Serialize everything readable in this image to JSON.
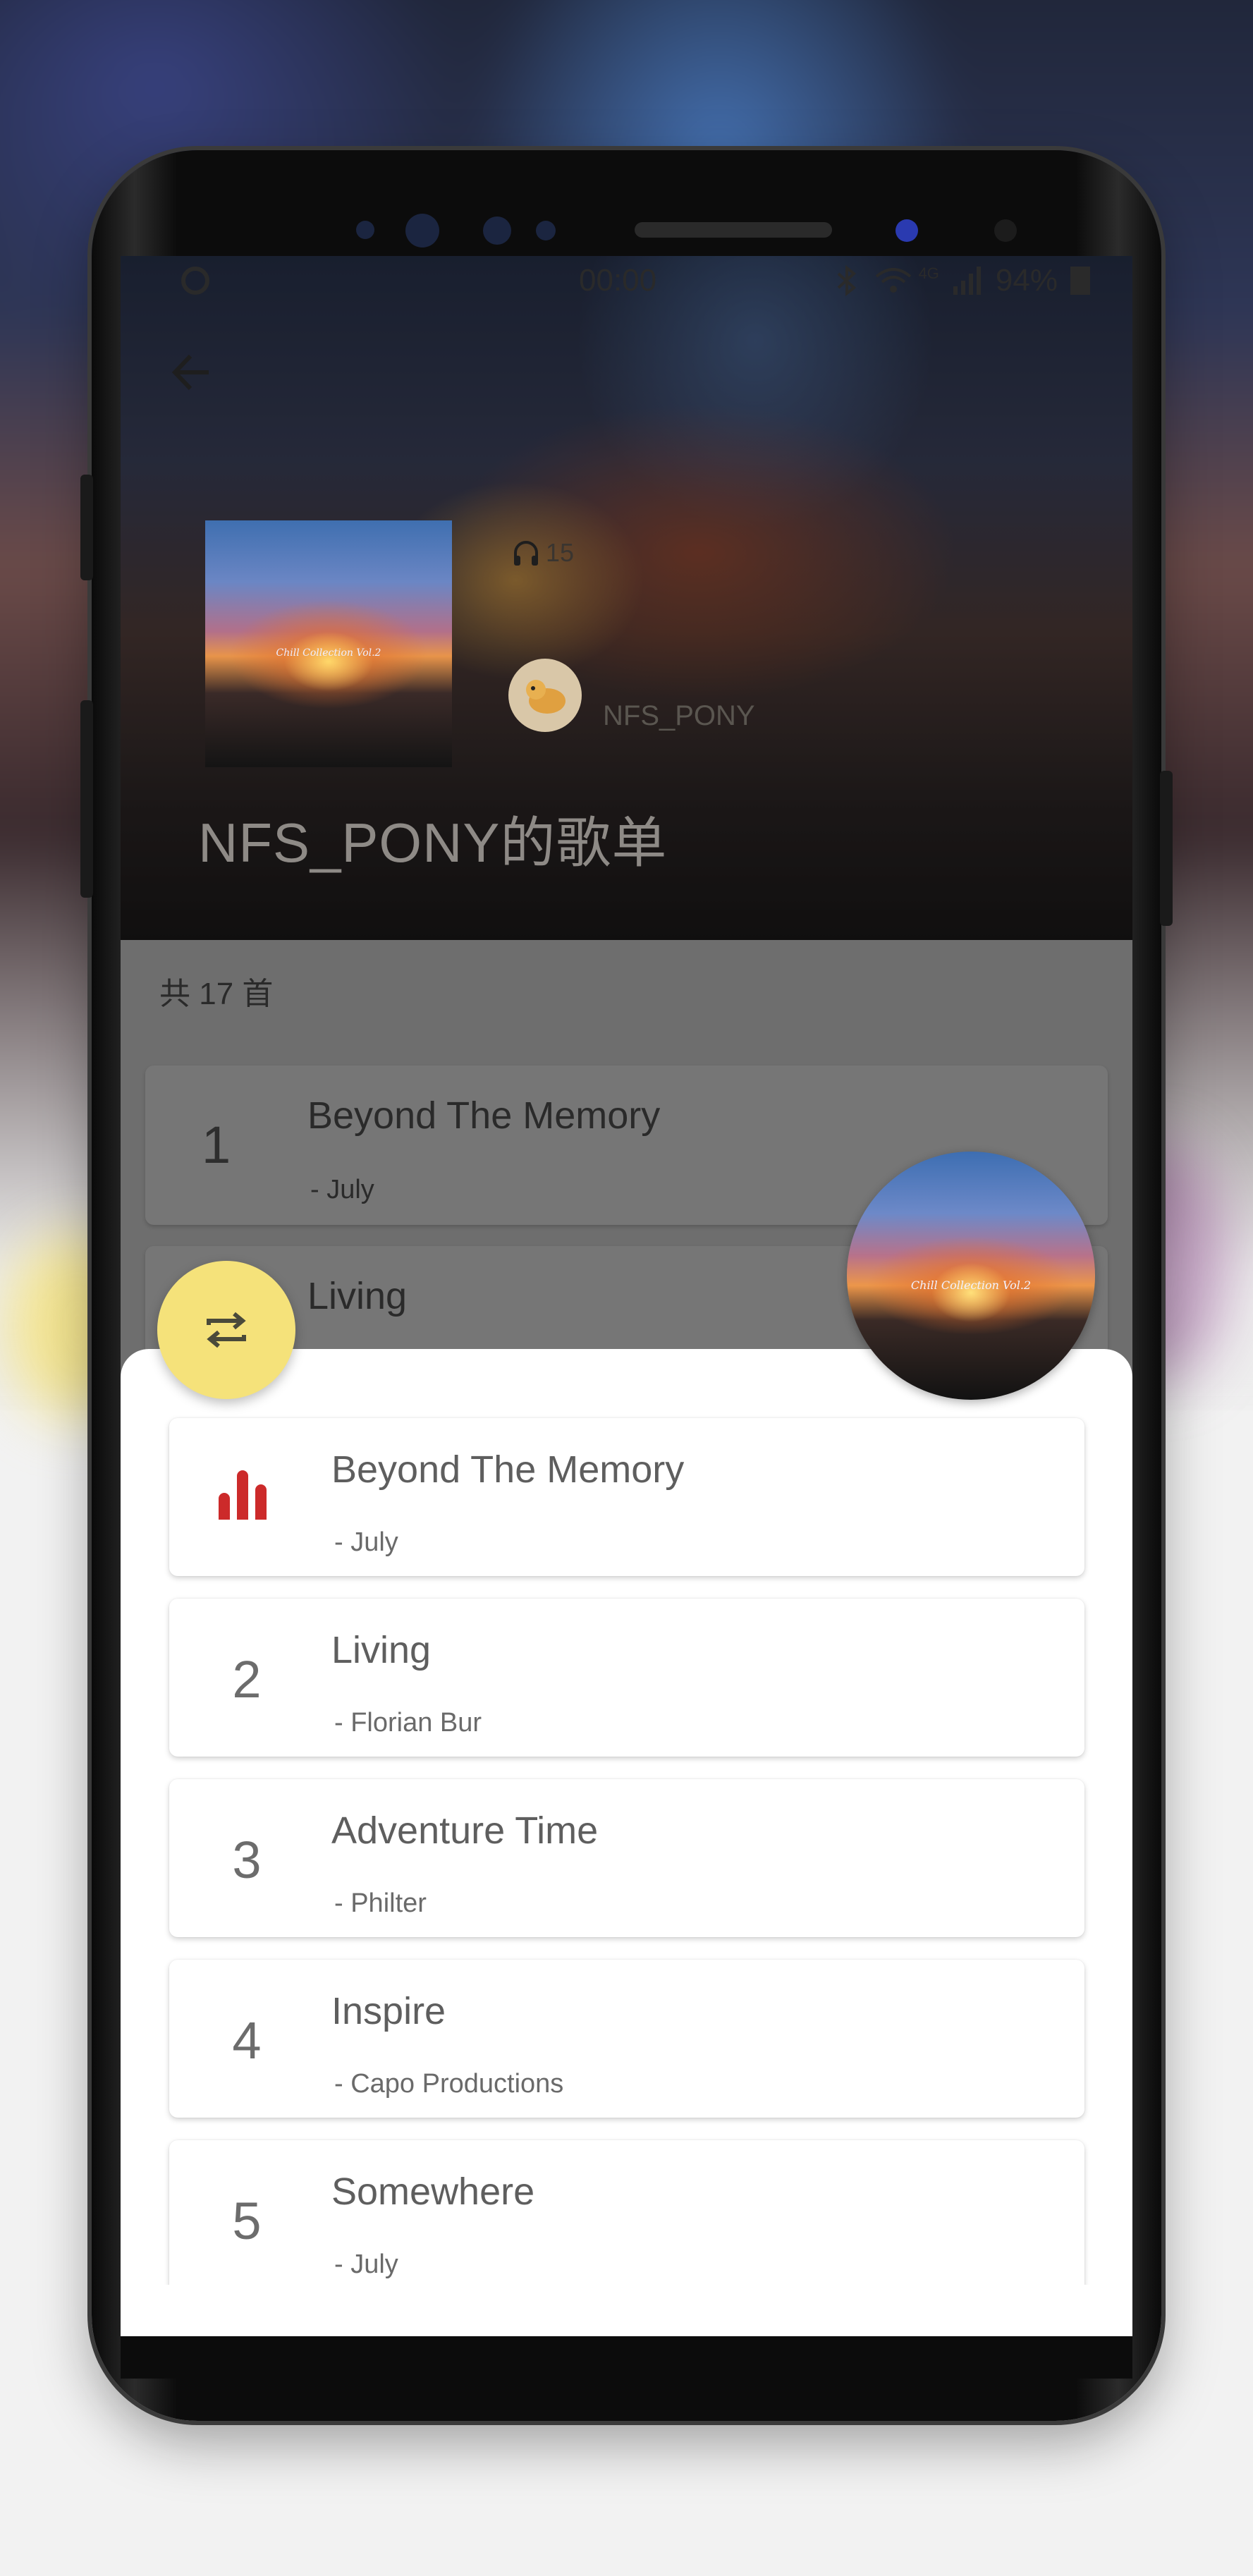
{
  "status_bar": {
    "time": "00:00",
    "signal_label": "4G",
    "battery": "94%"
  },
  "header": {
    "back_icon": "arrow-left-icon",
    "listen_count": "15",
    "creator_name": "NFS_PONY",
    "playlist_title": "NFS_PONY的歌单",
    "cover_text": "Chill Collection Vol.2"
  },
  "list": {
    "count_label": "共 17 首",
    "background_songs": [
      {
        "number": "1",
        "title": "Beyond The Memory",
        "artist": "- July"
      },
      {
        "number": "2",
        "title": "Living",
        "artist": ""
      }
    ]
  },
  "queue": {
    "repeat_icon": "repeat-icon",
    "now_playing_icon": "equalizer-icon",
    "songs": [
      {
        "number": "",
        "title": "Beyond The Memory",
        "artist": "- July",
        "playing": true
      },
      {
        "number": "2",
        "title": "Living",
        "artist": "- Florian Bur",
        "playing": false
      },
      {
        "number": "3",
        "title": "Adventure Time",
        "artist": "- Philter",
        "playing": false
      },
      {
        "number": "4",
        "title": "Inspire",
        "artist": "- Capo Productions",
        "playing": false
      },
      {
        "number": "5",
        "title": "Somewhere",
        "artist": "- July",
        "playing": false
      }
    ]
  },
  "colors": {
    "accent_fab": "#f5e27a",
    "now_playing": "#cc2a2a"
  }
}
